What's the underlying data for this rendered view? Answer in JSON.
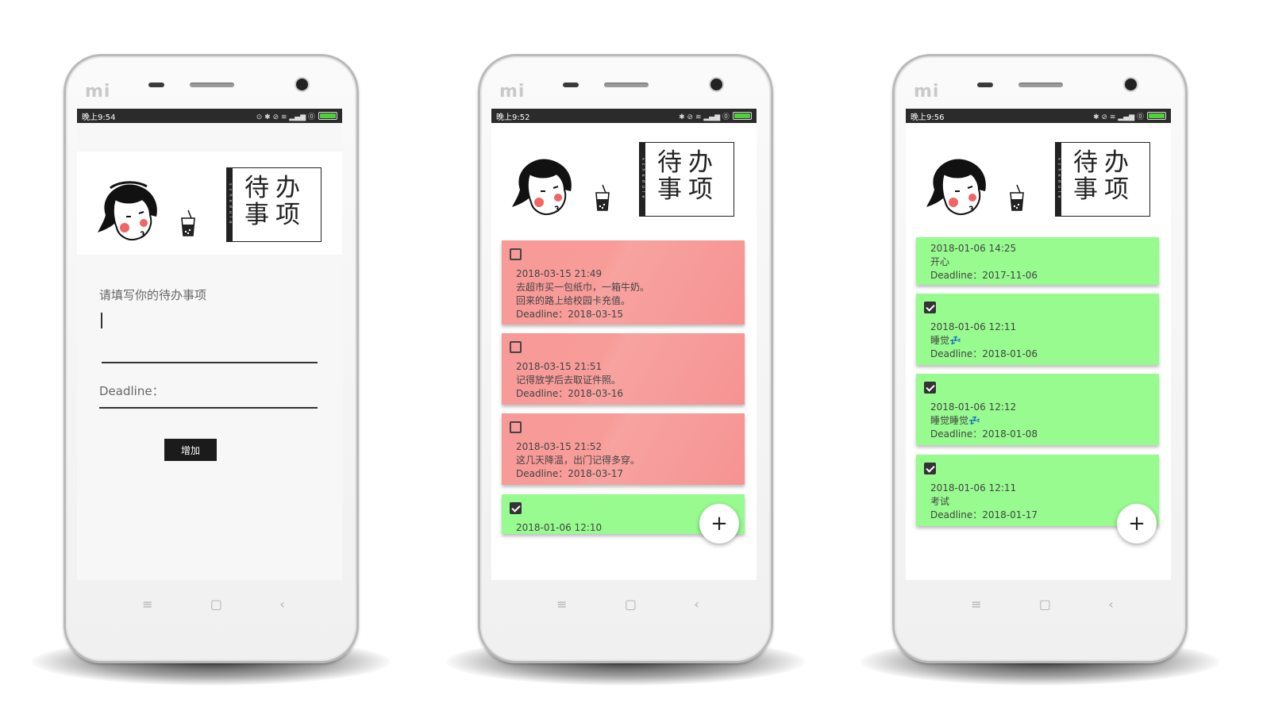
{
  "phones": [
    {
      "status": {
        "time": "晚上9:54",
        "icons": "⊙ ✱ ⊘ ≋ ▂▄▆ ⓪"
      },
      "form": {
        "prompt": "请填写你的待办事项",
        "deadline_label": "Deadline：",
        "add_button": "增加"
      }
    },
    {
      "status": {
        "time": "晚上9:52",
        "icons": "✱ ⊘ ≋ ▂▄▆ ⓪"
      },
      "cards": [
        {
          "checked": false,
          "created": "2018-03-15 21:49",
          "text": "去超市买一包纸巾，一箱牛奶。\n回来的路上给校园卡充值。",
          "deadline": "Deadline：2018-03-15",
          "color": "red"
        },
        {
          "checked": false,
          "created": "2018-03-15 21:51",
          "text": "记得放学后去取证件照。",
          "deadline": "Deadline：2018-03-16",
          "color": "red"
        },
        {
          "checked": false,
          "created": "2018-03-15 21:52",
          "text": "这几天降温，出门记得多穿。",
          "deadline": "Deadline：2018-03-17",
          "color": "red"
        },
        {
          "checked": true,
          "created": "2018-01-06 12:10",
          "text": "",
          "deadline": "",
          "color": "green"
        }
      ],
      "fab": "+"
    },
    {
      "status": {
        "time": "晚上9:56",
        "icons": "✱ ⊘ ≋ ▂▄▆ ⓪"
      },
      "cards": [
        {
          "checked": false,
          "created": "2018-01-06 14:25",
          "text": "开心",
          "deadline": "Deadline：2017-11-06",
          "color": "green"
        },
        {
          "checked": true,
          "created": "2018-01-06 12:11",
          "text": "睡觉💤",
          "deadline": "Deadline：2018-01-06",
          "color": "green"
        },
        {
          "checked": true,
          "created": "2018-01-06 12:12",
          "text": "睡觉睡觉💤",
          "deadline": "Deadline：2018-01-08",
          "color": "green"
        },
        {
          "checked": true,
          "created": "2018-01-06 12:11",
          "text": "考试",
          "deadline": "Deadline：2018-01-17",
          "color": "green"
        }
      ],
      "fab": "+"
    }
  ],
  "header": {
    "title_line1": "待办",
    "title_line2": "事项",
    "strip_text": "schedule"
  },
  "device": {
    "logo": "mi",
    "nav_menu": "≡",
    "nav_home": "▢",
    "nav_back": "‹"
  },
  "colors": {
    "card_red": "#f79a98",
    "card_green": "#97fb8f",
    "status_bar": "#2b2b2b",
    "button": "#1b1b1b"
  }
}
